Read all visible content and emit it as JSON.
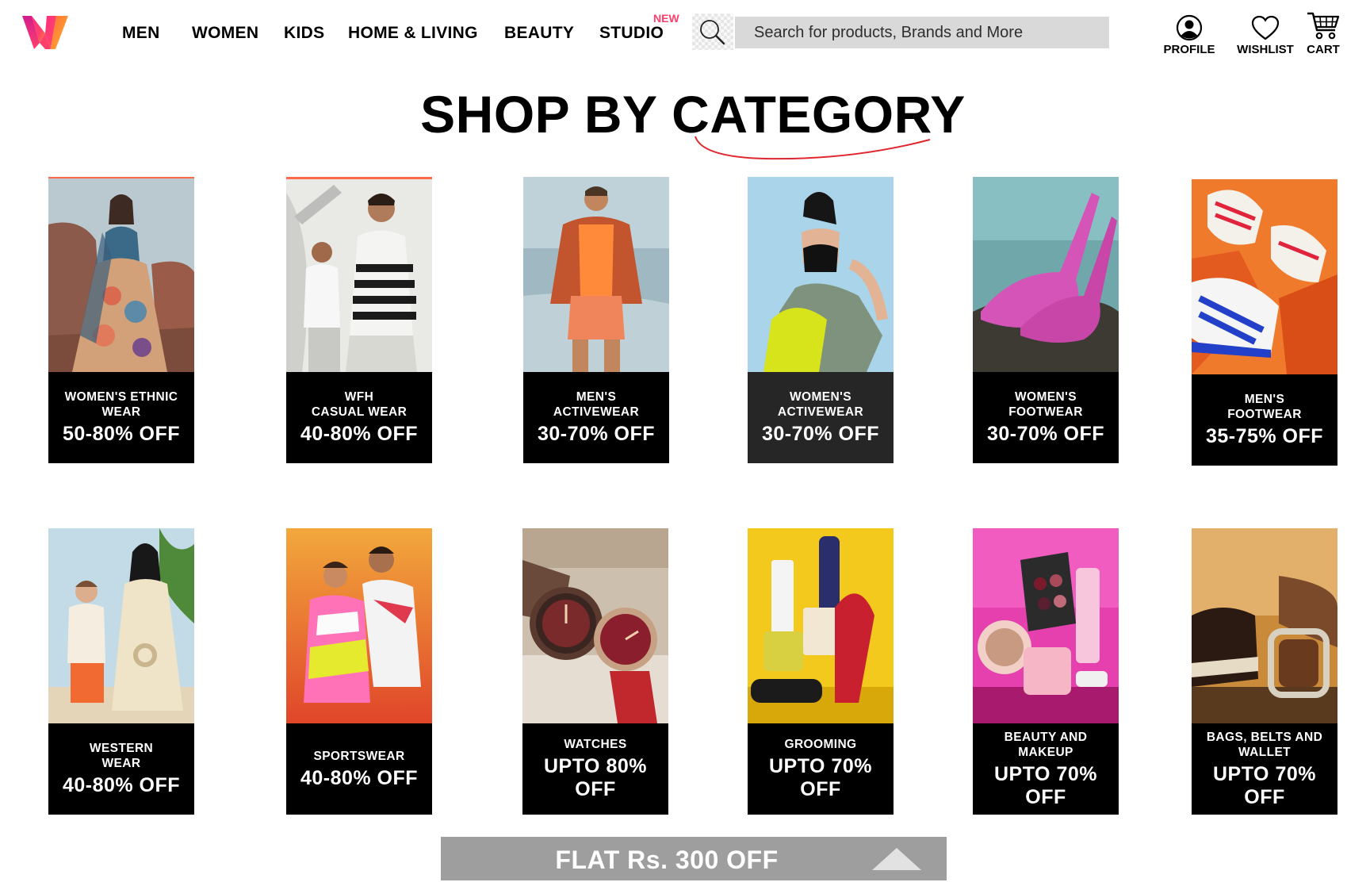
{
  "header": {
    "logo": "myntra-logo",
    "nav": [
      {
        "label": "MEN"
      },
      {
        "label": "WOMEN"
      },
      {
        "label": "KIDS"
      },
      {
        "label": "HOME & LIVING"
      },
      {
        "label": "BEAUTY"
      },
      {
        "label": "STUDIO",
        "badge": "NEW"
      }
    ],
    "search": {
      "placeholder": "Search for products, Brands and More",
      "value": ""
    },
    "actions": [
      {
        "label": "PROFILE",
        "icon": "profile-icon"
      },
      {
        "label": "WISHLIST",
        "icon": "heart-icon"
      },
      {
        "label": "CART",
        "icon": "cart-icon"
      }
    ]
  },
  "section": {
    "title": "SHOP BY CATEGORY"
  },
  "categories": [
    {
      "name": "WOMEN'S ETHNIC\nWEAR",
      "offer": "50-80% OFF"
    },
    {
      "name": "WFH\nCASUAL WEAR",
      "offer": "40-80% OFF"
    },
    {
      "name": "MEN'S\nACTIVEWEAR",
      "offer": "30-70% OFF"
    },
    {
      "name": "WOMEN'S\nACTIVEWEAR",
      "offer": "30-70% OFF"
    },
    {
      "name": "WOMEN'S\nFOOTWEAR",
      "offer": "30-70% OFF"
    },
    {
      "name": "MEN'S\nFOOTWEAR",
      "offer": "35-75% OFF"
    },
    {
      "name": "WESTERN\nWEAR",
      "offer": "40-80% OFF"
    },
    {
      "name": "SPORTSWEAR",
      "offer": "40-80%\nOFF"
    },
    {
      "name": "WATCHES",
      "offer": "UPTO 80%\nOFF"
    },
    {
      "name": "GROOMING",
      "offer": "UPTO 70%\nOFF"
    },
    {
      "name": "BEAUTY AND\nMAKEUP",
      "offer": "UPTO 70%\nOFF"
    },
    {
      "name": "BAGS, BELTS AND\nWALLET",
      "offer": "UPTO 70%\nOFF"
    }
  ],
  "promo_bar": {
    "text": "FLAT Rs. 300 OFF",
    "icon": "triangle-up-icon"
  },
  "colors": {
    "accent": "#ff3f6c",
    "label_bg": "#000000",
    "promo_bg": "#9e9e9e",
    "search_bg": "#d9d9d9"
  }
}
